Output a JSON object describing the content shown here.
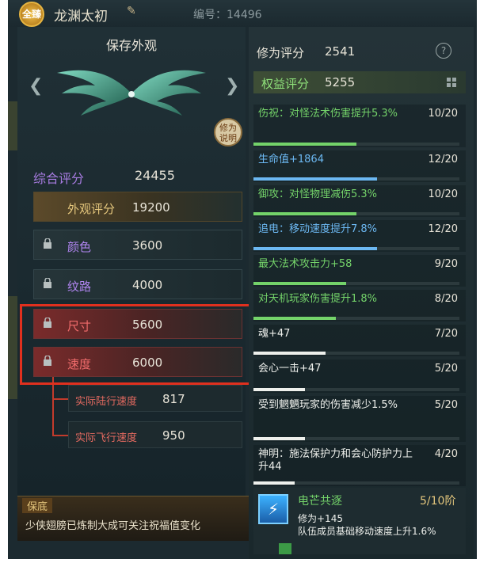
{
  "header": {
    "badge": "全臻",
    "character_name": "龙渊太初",
    "id_label": "编号：14496"
  },
  "left_panel": {
    "title": "保存外观",
    "modify_label": "修为说明",
    "total": {
      "label": "综合评分",
      "value": "24455"
    },
    "appearance": {
      "label": "外观评分",
      "value": "19200"
    },
    "rows": [
      {
        "label": "颜色",
        "value": "3600",
        "style": "purple"
      },
      {
        "label": "纹路",
        "value": "4000",
        "style": "purple"
      },
      {
        "label": "尺寸",
        "value": "5600",
        "style": "red"
      },
      {
        "label": "速度",
        "value": "6000",
        "style": "red"
      }
    ],
    "sub_rows": [
      {
        "label": "实际陆行速度",
        "value": "817"
      },
      {
        "label": "实际飞行速度",
        "value": "950"
      }
    ]
  },
  "tip": {
    "tag": "保底",
    "text": "少侠翅膀已炼制大成可关注祝福值变化"
  },
  "right_panel": {
    "cultivation": {
      "label": "修为评分",
      "value": "2541"
    },
    "help_icon": "?",
    "rights": {
      "label": "权益评分",
      "value": "5255"
    },
    "attributes": [
      {
        "text": "伤祝：对怪法术伤害提升5.3%",
        "count": "10/20",
        "color": "green",
        "progress": 0.5
      },
      {
        "text": "生命值+1864",
        "count": "12/20",
        "color": "blue",
        "progress": 0.6
      },
      {
        "text": "御攻：对怪物理减伤5.3%",
        "count": "10/20",
        "color": "green",
        "progress": 0.5
      },
      {
        "text": "追电：移动速度提升7.8%",
        "count": "12/20",
        "color": "blue",
        "progress": 0.6
      },
      {
        "text": "最大法术攻击力+58",
        "count": "9/20",
        "color": "green",
        "progress": 0.45
      },
      {
        "text": "对天机玩家伤害提升1.8%",
        "count": "8/20",
        "color": "green",
        "progress": 0.4
      },
      {
        "text": "魂+47",
        "count": "7/20",
        "color": "white",
        "progress": 0.35
      },
      {
        "text": "会心一击+47",
        "count": "5/20",
        "color": "white",
        "progress": 0.25
      },
      {
        "text": "受到魍魉玩家的伤害减少1.5%",
        "count": "5/20",
        "color": "white",
        "progress": 0.25
      },
      {
        "text": "神明：施法保护力和会心防护力上升44",
        "count": "4/20",
        "color": "white",
        "progress": 0.2
      }
    ],
    "skill": {
      "name": "电芒共逐",
      "level": "5/10阶",
      "line1": "修为+145",
      "line2": "队伍成员基础移动速度上升1.6%"
    }
  },
  "colors": {
    "green": "#74d36a",
    "blue": "#6cb8f2",
    "white": "#eef0ec",
    "purple": "#b085f0",
    "red": "#f06b6b",
    "highlight": "#e0301e"
  }
}
